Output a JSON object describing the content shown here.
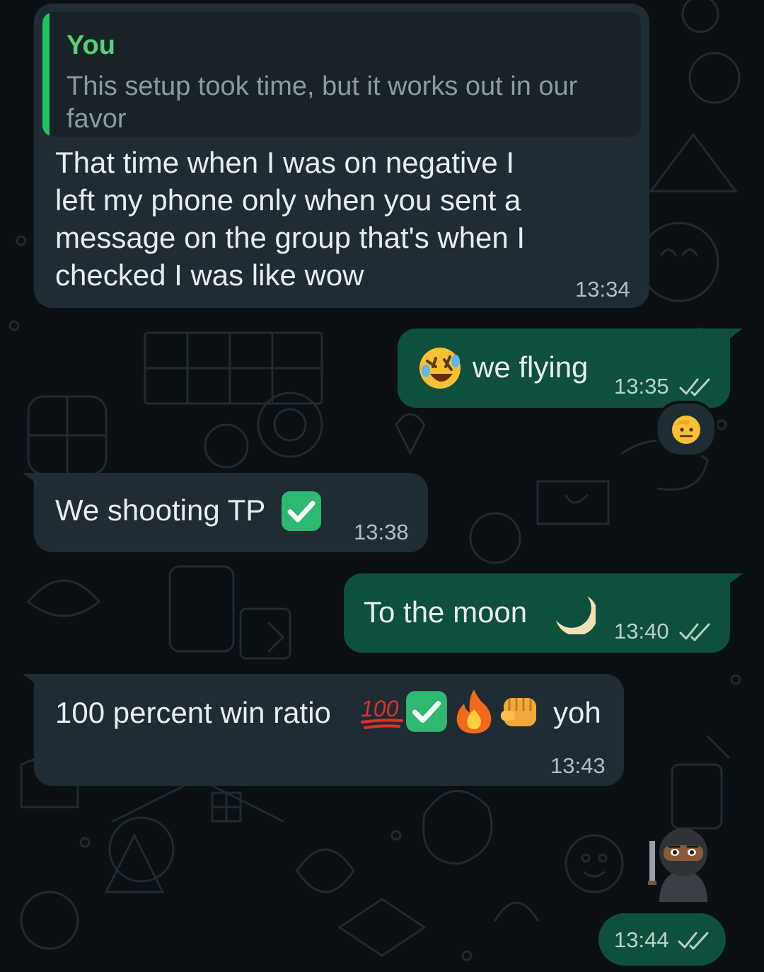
{
  "messages": [
    {
      "direction": "incoming",
      "quote": {
        "author": "You",
        "text": "This setup took time, but it works out in our favor"
      },
      "lines": [
        "That time when I was on negative I",
        "left my phone  only when you sent a",
        "message on the group that's when I",
        "checked I was like wow"
      ],
      "time": "13:34"
    },
    {
      "direction": "outgoing",
      "emoji": "rolling-on-floor-laughing",
      "text": "we flying",
      "time": "13:35",
      "status": "read",
      "reaction": "saluting-face"
    },
    {
      "direction": "incoming",
      "text": "We shooting TP",
      "emoji": "check-mark-button",
      "time": "13:38"
    },
    {
      "direction": "outgoing",
      "text": "To the moon",
      "emoji": "crescent-moon",
      "time": "13:40",
      "status": "read"
    },
    {
      "direction": "incoming",
      "text": "100 percent win ratio",
      "emojis": [
        "hundred-points",
        "check-mark-button",
        "fire",
        "oncoming-fist"
      ],
      "text_after": "yoh",
      "time": "13:43"
    },
    {
      "direction": "outgoing",
      "sticker": "ninja",
      "time": "13:44",
      "status": "read"
    }
  ],
  "colors": {
    "background": "#0b1014",
    "incoming_bubble": "#1f2c34",
    "outgoing_bubble": "#0f4f3d",
    "quote_accent": "#23c25f"
  }
}
